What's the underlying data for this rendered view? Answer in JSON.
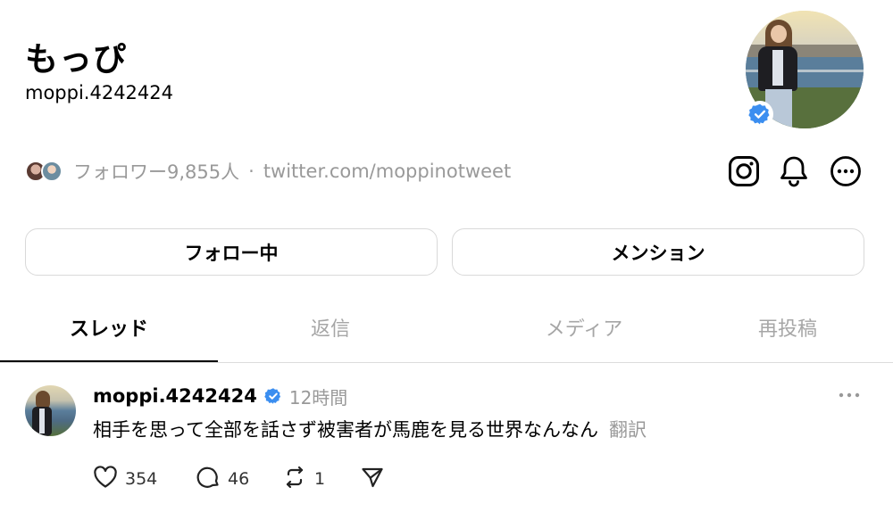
{
  "profile": {
    "display_name": "もっぴ",
    "username": "moppi.4242424",
    "followers_text": "フォロワー9,855人",
    "separator": "·",
    "link": "twitter.com/moppinotweet",
    "verified": true
  },
  "header_icons": [
    "instagram-icon",
    "bell-icon",
    "more-icon"
  ],
  "actions": {
    "follow_label": "フォロー中",
    "mention_label": "メンション"
  },
  "tabs": [
    {
      "label": "スレッド",
      "active": true
    },
    {
      "label": "返信",
      "active": false
    },
    {
      "label": "メディア",
      "active": false
    },
    {
      "label": "再投稿",
      "active": false
    }
  ],
  "post": {
    "username": "moppi.4242424",
    "time": "12時間",
    "text": "相手を思って全部を話さず被害者が馬鹿を見る世界なんなん",
    "translate_label": "翻訳",
    "likes": "354",
    "replies": "46",
    "reposts": "1"
  },
  "colors": {
    "verified_blue": "#3b8ef0",
    "muted_text": "#999999",
    "border": "#d9d9d9"
  }
}
